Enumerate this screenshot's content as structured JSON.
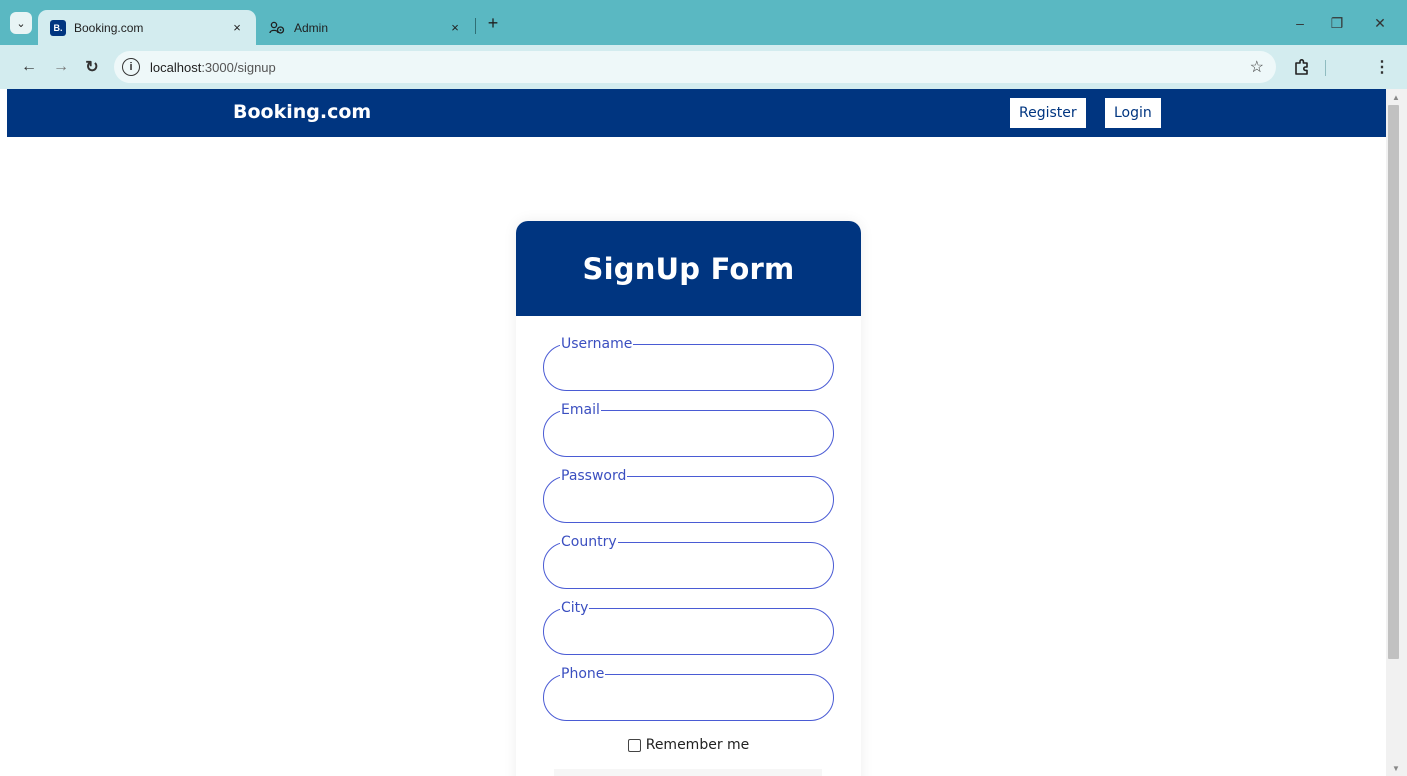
{
  "browser": {
    "tabs": [
      {
        "title": "Booking.com",
        "favicon": "B.",
        "active": true
      },
      {
        "title": "Admin",
        "favicon": "admin-icon",
        "active": false
      }
    ],
    "new_tab_symbol": "+",
    "close_symbol": "×",
    "url_host": "localhost",
    "url_path": ":3000/signup",
    "window_controls": {
      "minimize": "–",
      "restore": "❐",
      "close": "✕"
    }
  },
  "navbar": {
    "brand": "Booking.com",
    "register_label": "Register",
    "login_label": "Login",
    "background_color": "#003580"
  },
  "signup": {
    "title": "SignUp Form",
    "fields": [
      {
        "label": "Username",
        "value": ""
      },
      {
        "label": "Email",
        "value": ""
      },
      {
        "label": "Password",
        "value": ""
      },
      {
        "label": "Country",
        "value": ""
      },
      {
        "label": "City",
        "value": ""
      },
      {
        "label": "Phone",
        "value": ""
      }
    ],
    "remember_label": "Remember me",
    "remember_checked": false,
    "accent_color": "#4a5bd4"
  }
}
